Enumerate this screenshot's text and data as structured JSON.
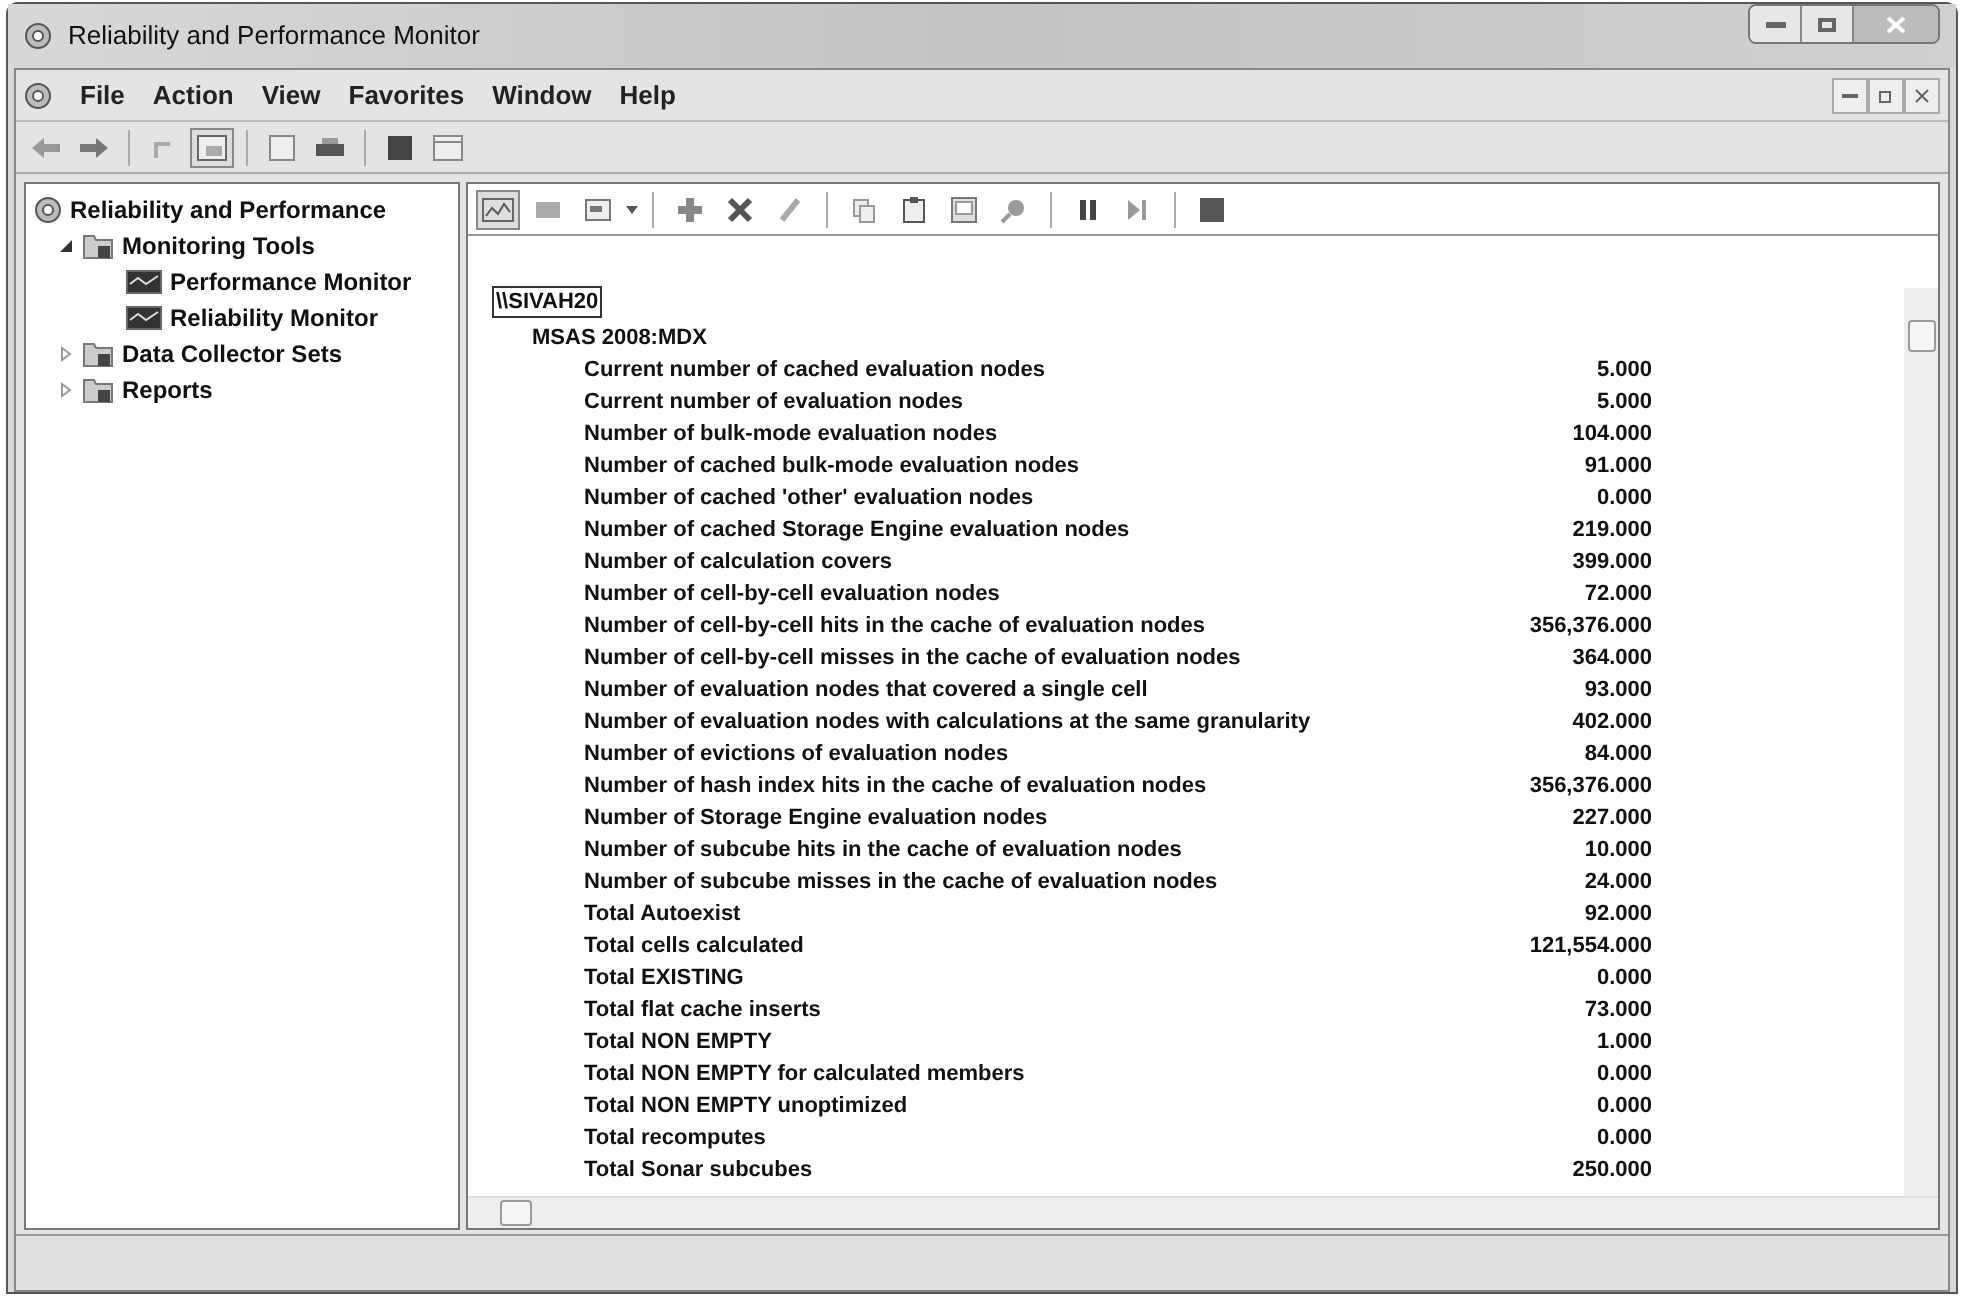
{
  "window": {
    "title": "Reliability and Performance Monitor"
  },
  "menu": [
    "File",
    "Action",
    "View",
    "Favorites",
    "Window",
    "Help"
  ],
  "tree": [
    {
      "label": "Reliability and Performance",
      "kind": "root",
      "children": [
        {
          "label": "Monitoring Tools",
          "kind": "folder",
          "expanded": true,
          "children": [
            {
              "label": "Performance Monitor",
              "kind": "monitor"
            },
            {
              "label": "Reliability Monitor",
              "kind": "monitor"
            }
          ]
        },
        {
          "label": "Data Collector Sets",
          "kind": "folder",
          "expanded": false
        },
        {
          "label": "Reports",
          "kind": "folder",
          "expanded": false
        }
      ]
    }
  ],
  "report": {
    "computer": "\\\\SIVAH20",
    "object": "MSAS 2008:MDX",
    "counters": [
      {
        "name": "Current number of cached evaluation nodes",
        "value": "5.000"
      },
      {
        "name": "Current number of evaluation nodes",
        "value": "5.000"
      },
      {
        "name": "Number of bulk-mode evaluation nodes",
        "value": "104.000"
      },
      {
        "name": "Number of cached bulk-mode evaluation nodes",
        "value": "91.000"
      },
      {
        "name": "Number of cached 'other' evaluation nodes",
        "value": "0.000"
      },
      {
        "name": "Number of cached Storage Engine evaluation nodes",
        "value": "219.000"
      },
      {
        "name": "Number of calculation covers",
        "value": "399.000"
      },
      {
        "name": "Number of cell-by-cell evaluation nodes",
        "value": "72.000"
      },
      {
        "name": "Number of cell-by-cell hits in the cache of evaluation nodes",
        "value": "356,376.000"
      },
      {
        "name": "Number of cell-by-cell misses in the cache of evaluation nodes",
        "value": "364.000"
      },
      {
        "name": "Number of evaluation nodes that covered a single cell",
        "value": "93.000"
      },
      {
        "name": "Number of evaluation nodes with calculations at the same granularity",
        "value": "402.000"
      },
      {
        "name": "Number of evictions of evaluation nodes",
        "value": "84.000"
      },
      {
        "name": "Number of hash index hits in the cache of evaluation nodes",
        "value": "356,376.000"
      },
      {
        "name": "Number of Storage Engine evaluation nodes",
        "value": "227.000"
      },
      {
        "name": "Number of subcube hits in the cache of evaluation nodes",
        "value": "10.000"
      },
      {
        "name": "Number of subcube misses in the cache of evaluation nodes",
        "value": "24.000"
      },
      {
        "name": "Total Autoexist",
        "value": "92.000"
      },
      {
        "name": "Total cells calculated",
        "value": "121,554.000"
      },
      {
        "name": "Total EXISTING",
        "value": "0.000"
      },
      {
        "name": "Total flat cache inserts",
        "value": "73.000"
      },
      {
        "name": "Total NON EMPTY",
        "value": "1.000"
      },
      {
        "name": "Total NON EMPTY for calculated members",
        "value": "0.000"
      },
      {
        "name": "Total NON EMPTY unoptimized",
        "value": "0.000"
      },
      {
        "name": "Total recomputes",
        "value": "0.000"
      },
      {
        "name": "Total Sonar subcubes",
        "value": "250.000"
      }
    ]
  }
}
